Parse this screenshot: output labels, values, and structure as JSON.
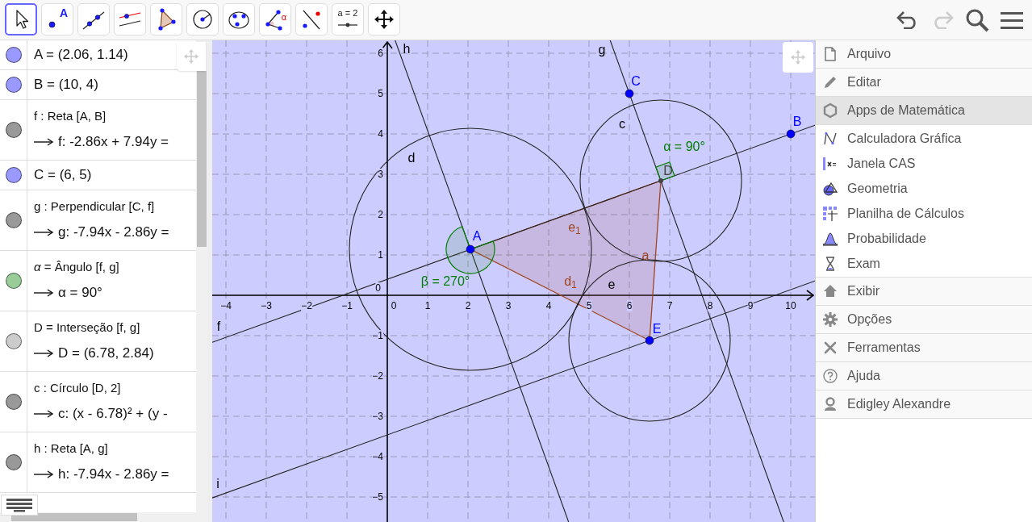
{
  "toolbar": {
    "tools": [
      {
        "selected": true
      },
      {
        "selected": false,
        "label": "A"
      },
      {
        "selected": false
      },
      {
        "selected": false
      },
      {
        "selected": false
      },
      {
        "selected": false
      },
      {
        "selected": false
      },
      {
        "selected": false,
        "label": "α"
      },
      {
        "selected": false
      },
      {
        "selected": false,
        "label": "a = 2"
      },
      {
        "selected": false
      }
    ],
    "actions": [
      {
        "kind": "undo",
        "disabled": false
      },
      {
        "kind": "redo",
        "disabled": true
      },
      {
        "kind": "search"
      },
      {
        "kind": "menu"
      }
    ]
  },
  "algebra": {
    "items": [
      {
        "color": "#9999ff",
        "definition": "A = (2.06, 1.14)"
      },
      {
        "color": "#9999ff",
        "definition": "B = (10, 4)"
      },
      {
        "color": "#999999",
        "definition": "f : Reta [A, B]",
        "result": "f: -2.86x + 7.94y ="
      },
      {
        "color": "#9999ff",
        "definition": "C = (6, 5)"
      },
      {
        "color": "#999999",
        "definition": "g : Perpendicular [C, f]",
        "result": "g: -7.94x - 2.86y ="
      },
      {
        "color": "#99cc99",
        "definition": "*α* = Ângulo [f, g]",
        "result": "α = 90°"
      },
      {
        "color": "#cccccc",
        "definition": "D = Interseção [f, g]",
        "result": "D = (6.78, 2.84)"
      },
      {
        "color": "#999999",
        "definition": "c : Círculo [D, 2]",
        "result": "c: (x - 6.78)² + (y -"
      },
      {
        "color": "#999999",
        "definition": "h : Reta [A, g]",
        "result": "h: -7.94x - 2.86y ="
      }
    ]
  },
  "graphics": {
    "x_ticks": [
      "−4",
      "−3",
      "−2",
      "−1",
      "0",
      "1",
      "2",
      "3",
      "4",
      "5",
      "6",
      "7",
      "8",
      "9",
      "10"
    ],
    "y_ticks": [
      "6",
      "5",
      "4",
      "3",
      "2",
      "1",
      "0",
      "−1",
      "−2",
      "−3",
      "−4",
      "−5"
    ],
    "labels": [
      {
        "text": "h",
        "kind": "line"
      },
      {
        "text": "g",
        "kind": "line"
      },
      {
        "text": "C",
        "kind": "point"
      },
      {
        "text": "B",
        "kind": "point"
      },
      {
        "text": "c",
        "kind": "line"
      },
      {
        "text": "d",
        "kind": "line"
      },
      {
        "text": "α = 90°",
        "kind": "angle"
      },
      {
        "text": "D",
        "kind": "dependent_point"
      },
      {
        "text": "A",
        "kind": "point"
      },
      {
        "text": "e$_{1}$",
        "kind": "segment"
      },
      {
        "text": "a",
        "kind": "segment"
      },
      {
        "text": "β = 270°",
        "kind": "angle"
      },
      {
        "text": "d$_{1}$",
        "kind": "segment"
      },
      {
        "text": "e",
        "kind": "line"
      },
      {
        "text": "E",
        "kind": "point"
      },
      {
        "text": "f",
        "kind": "line"
      },
      {
        "text": "i",
        "kind": "line"
      }
    ]
  },
  "menu": {
    "items": [
      {
        "label": "Arquivo"
      },
      {
        "label": "Editar"
      },
      {
        "label": "Apps de Matemática",
        "expanded": true,
        "children": [
          {
            "label": "Calculadora Gráfica"
          },
          {
            "label": "Janela CAS"
          },
          {
            "label": "Geometria"
          },
          {
            "label": "Planilha de Cálculos"
          },
          {
            "label": "Probabilidade"
          },
          {
            "label": "Exam"
          }
        ]
      },
      {
        "label": "Exibir"
      },
      {
        "label": "Opções"
      },
      {
        "label": "Ferramentas"
      },
      {
        "label": "Ajuda"
      },
      {
        "label": "Edigley Alexandre"
      }
    ]
  }
}
